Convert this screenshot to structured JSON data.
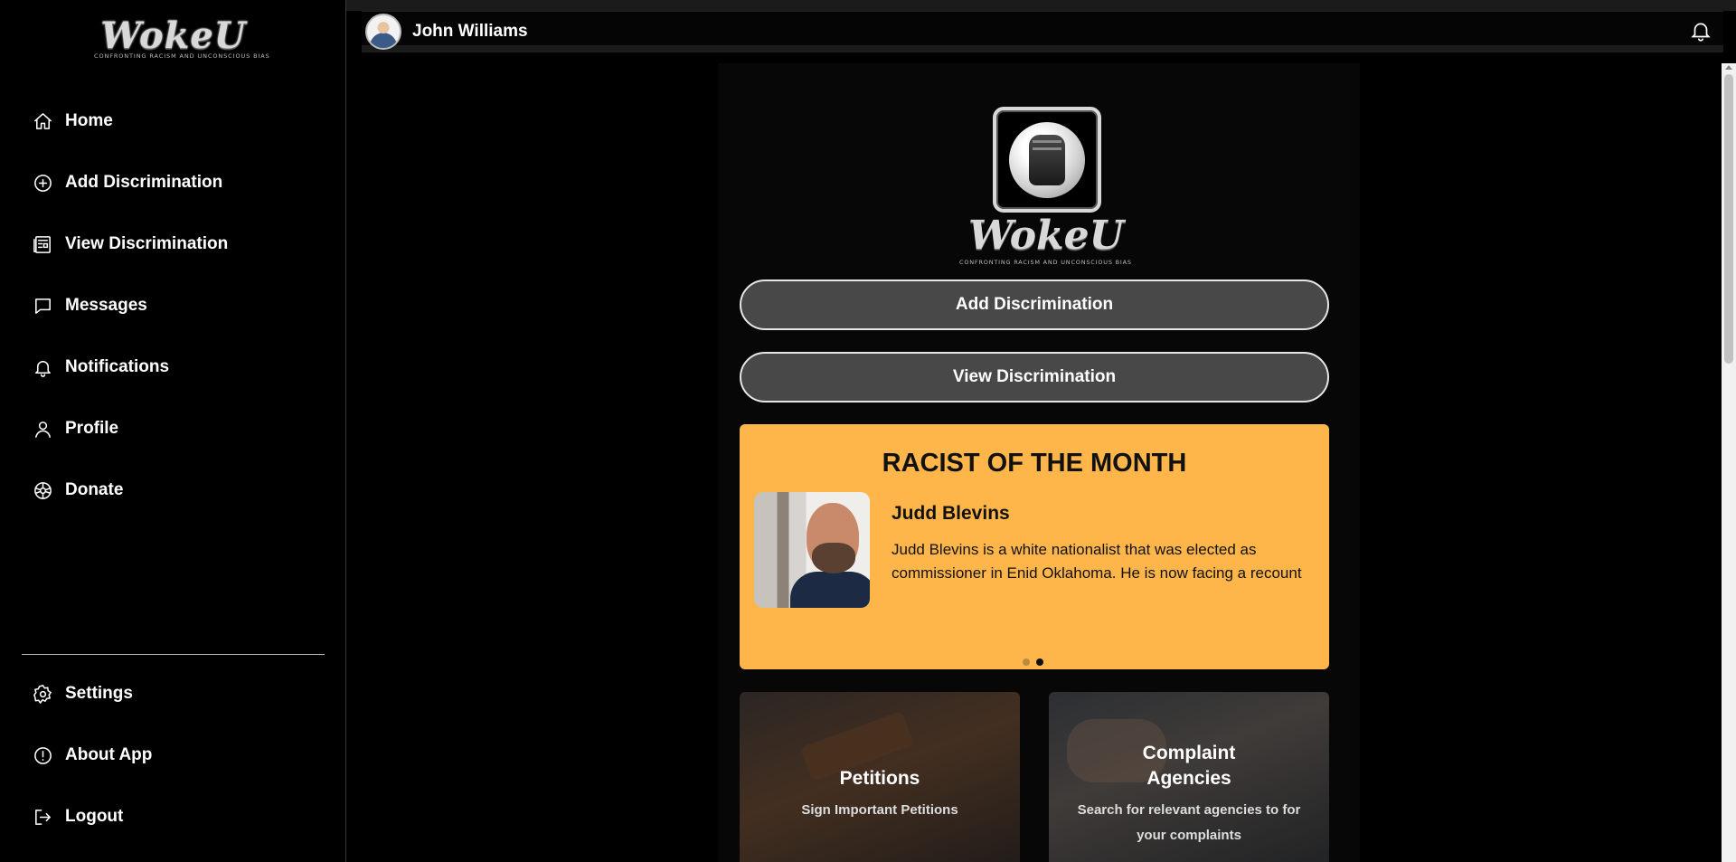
{
  "brand": {
    "name": "WokeU",
    "tagline": "CONFRONTING RACISM AND UNCONSCIOUS BIAS"
  },
  "sidebar": {
    "items": [
      {
        "label": "Home",
        "icon": "home-icon"
      },
      {
        "label": "Add Discrimination",
        "icon": "plus-circle-icon"
      },
      {
        "label": "View Discrimination",
        "icon": "newspaper-icon"
      },
      {
        "label": "Messages",
        "icon": "chat-bubble-icon"
      },
      {
        "label": "Notifications",
        "icon": "bell-icon"
      },
      {
        "label": "Profile",
        "icon": "user-icon"
      },
      {
        "label": "Donate",
        "icon": "donate-icon"
      }
    ],
    "bottom_items": [
      {
        "label": "Settings",
        "icon": "gear-icon"
      },
      {
        "label": "About App",
        "icon": "info-circle-icon"
      },
      {
        "label": "Logout",
        "icon": "logout-icon"
      }
    ]
  },
  "header": {
    "user_name": "John Williams"
  },
  "main": {
    "add_button": "Add Discrimination",
    "view_button": "View Discrimination",
    "racist_of_month": {
      "title": "RACIST OF THE MONTH",
      "name": "Judd Blevins",
      "description": "Judd Blevins is a white nationalist that was elected as commissioner in Enid Oklahoma. He is now facing a recount",
      "active_slide": 2,
      "total_slides": 2
    },
    "cards": [
      {
        "title": "Petitions",
        "subtitle": "Sign Important Petitions"
      },
      {
        "title": "Complaint Agencies",
        "subtitle": "Search for relevant agencies to for your complaints"
      }
    ]
  },
  "colors": {
    "accent": "#feb54a",
    "button": "#484848",
    "background": "#000000"
  }
}
